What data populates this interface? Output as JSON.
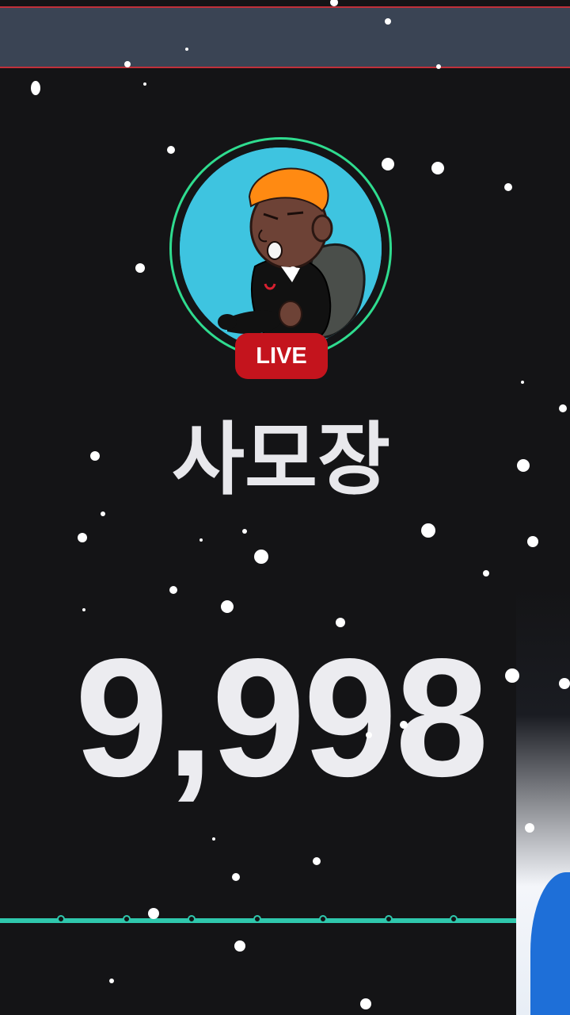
{
  "stream": {
    "live_label": "LIVE",
    "streamer_name": "사모장",
    "count": "9,998"
  },
  "colors": {
    "background": "#141416",
    "top_bar": "#3a4454",
    "accent_ring": "#2fdc8f",
    "live_badge": "#c4141d",
    "progress_line": "#2fc8ad",
    "text": "#ececf0"
  },
  "icons": {
    "avatar": "cartoon-character-avatar-icon"
  }
}
